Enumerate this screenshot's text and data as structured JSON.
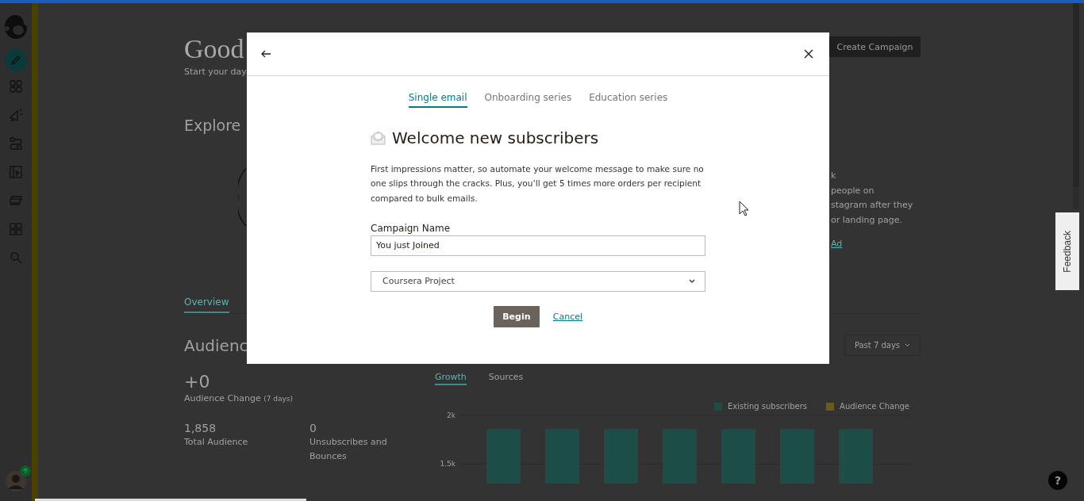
{
  "page": {
    "greeting": "Good",
    "subtitle": "Start your day",
    "create_button": "Create Campaign",
    "explore_heading": "Explore",
    "promo_lines": [
      "k",
      "people on",
      "stagram after they",
      "or landing page."
    ],
    "promo_link": "Ad",
    "tabs": [
      {
        "label": "Overview",
        "selected": true
      }
    ],
    "audience_heading": "Audienc",
    "range_dropdown": "Past 7 days",
    "audience_change": {
      "value": "+0",
      "label": "Audience Change",
      "note": "(7 days)"
    },
    "stats": [
      {
        "value": "1,858",
        "label": "Total Audience"
      },
      {
        "value": "0",
        "label": "Unsubscribes and Bounces"
      }
    ],
    "chart_tabs": [
      {
        "label": "Growth",
        "selected": true
      },
      {
        "label": "Sources",
        "selected": false
      }
    ],
    "chart": {
      "chart_data": {
        "type": "bar",
        "ylim": [
          1300,
          2000
        ],
        "yticks": [
          {
            "value": 1500,
            "label": "1.5k"
          },
          {
            "value": 2000,
            "label": "2k"
          }
        ],
        "series": [
          {
            "name": "Existing subscribers",
            "color": "#1d4d47",
            "values": [
              1860,
              1860,
              1860,
              1860,
              1860,
              1860,
              1860
            ]
          },
          {
            "name": "Audience Change",
            "color": "#6b5a1a",
            "values": [
              null,
              null,
              null,
              null,
              null,
              null,
              null
            ]
          }
        ]
      }
    }
  },
  "feedback_tab": "Feedback",
  "help_button": "?",
  "dialog": {
    "tabs": [
      {
        "label": "Single email",
        "selected": true
      },
      {
        "label": "Onboarding series",
        "selected": false
      },
      {
        "label": "Education series",
        "selected": false
      }
    ],
    "heading": "Welcome new subscribers",
    "description": "First impressions matter, so automate your welcome message to make sure no one slips through the cracks. Plus, you’ll get 5 times more orders per recipient compared to bulk emails.",
    "field_label": "Campaign Name",
    "campaign_name": "You just Joined",
    "audience_select": "Coursera Project",
    "buttons": {
      "primary": "Begin",
      "secondary": "Cancel"
    }
  }
}
